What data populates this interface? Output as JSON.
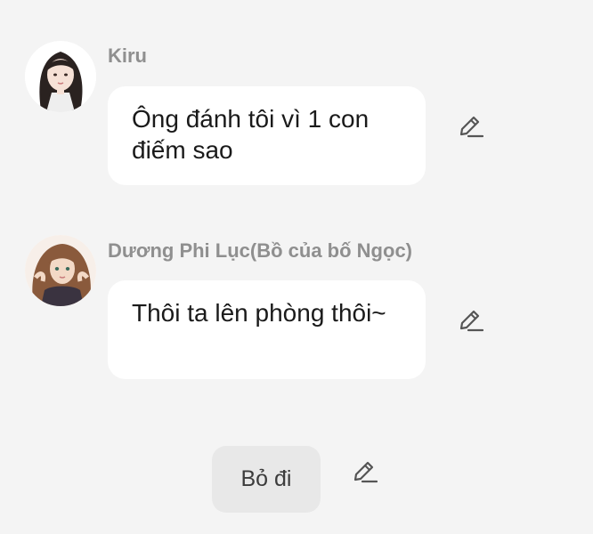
{
  "messages": [
    {
      "sender": "Kiru",
      "text": "Ông đánh tôi vì 1 con điếm sao",
      "avatar_icon": "girl-dark-hair-avatar",
      "edit_icon": "pencil-edit-icon"
    },
    {
      "sender": "Dương Phi Lục(Bồ của bố Ngọc)",
      "text": "Thôi ta lên phòng thôi~",
      "avatar_icon": "woman-brown-hair-avatar",
      "edit_icon": "pencil-edit-icon"
    }
  ],
  "actions": {
    "discard_label": "Bỏ đi",
    "discard_edit_icon": "pencil-edit-icon"
  },
  "colors": {
    "background": "#f4f4f4",
    "bubble": "#ffffff",
    "sender_text": "#8f8f8f",
    "button_bg": "#e8e8e8"
  }
}
